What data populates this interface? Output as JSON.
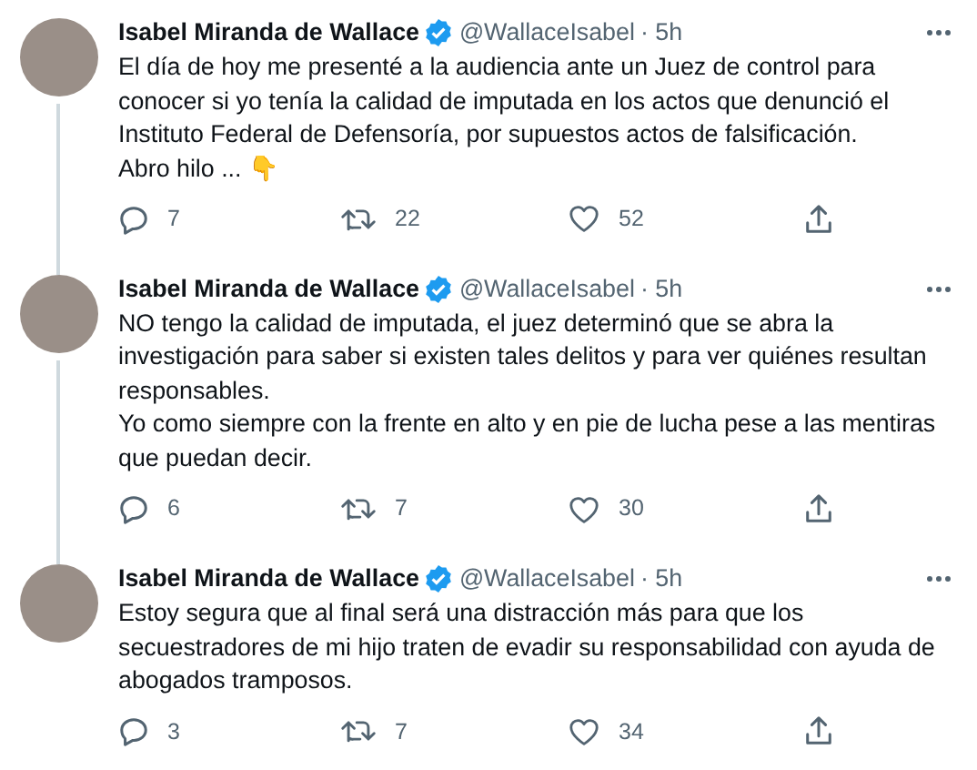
{
  "tweets": [
    {
      "name": "Isabel Miranda de Wallace",
      "verified": true,
      "handle": "@WallaceIsabel",
      "time": "· 5h",
      "text": "El día de hoy me presenté a la audiencia ante un Juez de control para conocer si yo tenía la calidad de imputada en los actos que denunció el Instituto Federal de Defensoría, por supuestos actos de falsificación.\nAbro hilo ... 👇",
      "replies": "7",
      "retweets": "22",
      "likes": "52",
      "thread_continues": true
    },
    {
      "name": "Isabel Miranda de Wallace",
      "verified": true,
      "handle": "@WallaceIsabel",
      "time": "· 5h",
      "text": "NO tengo la calidad de imputada, el juez determinó que se abra la investigación para saber si existen tales delitos y para ver quiénes resultan responsables.\nYo como siempre con la frente en alto y en pie de lucha pese a las mentiras que puedan decir.",
      "replies": "6",
      "retweets": "7",
      "likes": "30",
      "thread_continues": true
    },
    {
      "name": "Isabel Miranda de Wallace",
      "verified": true,
      "handle": "@WallaceIsabel",
      "time": "· 5h",
      "text": "Estoy segura que al final será una distracción más para que los secuestradores de mi hijo traten de evadir su responsabilidad con ayuda de abogados tramposos.",
      "replies": "3",
      "retweets": "7",
      "likes": "34",
      "thread_continues": false
    }
  ]
}
